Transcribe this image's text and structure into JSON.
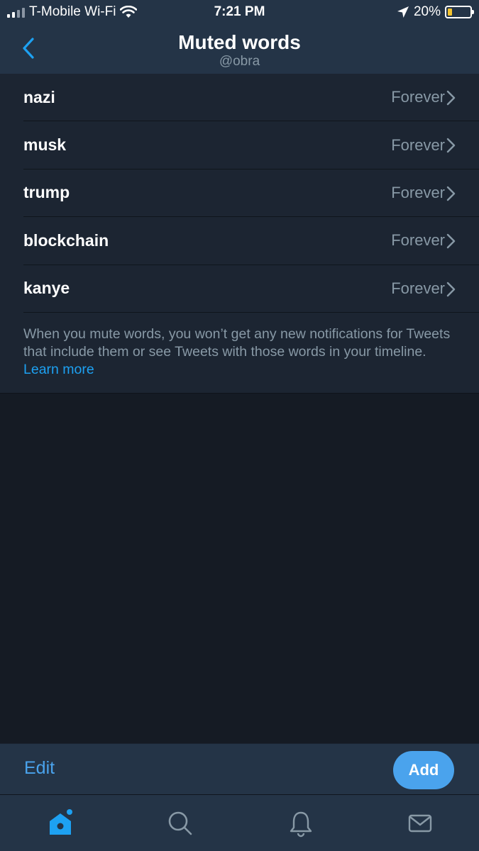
{
  "status_bar": {
    "carrier": "T-Mobile Wi-Fi",
    "time": "7:21 PM",
    "battery_percent": "20%",
    "battery_level": 0.2
  },
  "header": {
    "title": "Muted words",
    "subtitle": "@obra",
    "back_icon": "chevron-left-icon"
  },
  "muted_words": [
    {
      "word": "nazi",
      "duration": "Forever"
    },
    {
      "word": "musk",
      "duration": "Forever"
    },
    {
      "word": "trump",
      "duration": "Forever"
    },
    {
      "word": "blockchain",
      "duration": "Forever"
    },
    {
      "word": "kanye",
      "duration": "Forever"
    }
  ],
  "info": {
    "text": "When you mute words, you won’t get any new notifications for Tweets that include them or see Tweets with those words in your timeline.",
    "link": "Learn more"
  },
  "actions": {
    "edit_label": "Edit",
    "add_label": "Add"
  },
  "tabs": [
    "home-icon",
    "search-icon",
    "notifications-icon",
    "messages-icon"
  ],
  "colors": {
    "accent": "#1da1f2",
    "header_bg": "#243447",
    "list_bg": "#1c2532",
    "page_bg": "#151b24",
    "secondary_text": "#8899a6",
    "battery_low": "#f4c430"
  }
}
